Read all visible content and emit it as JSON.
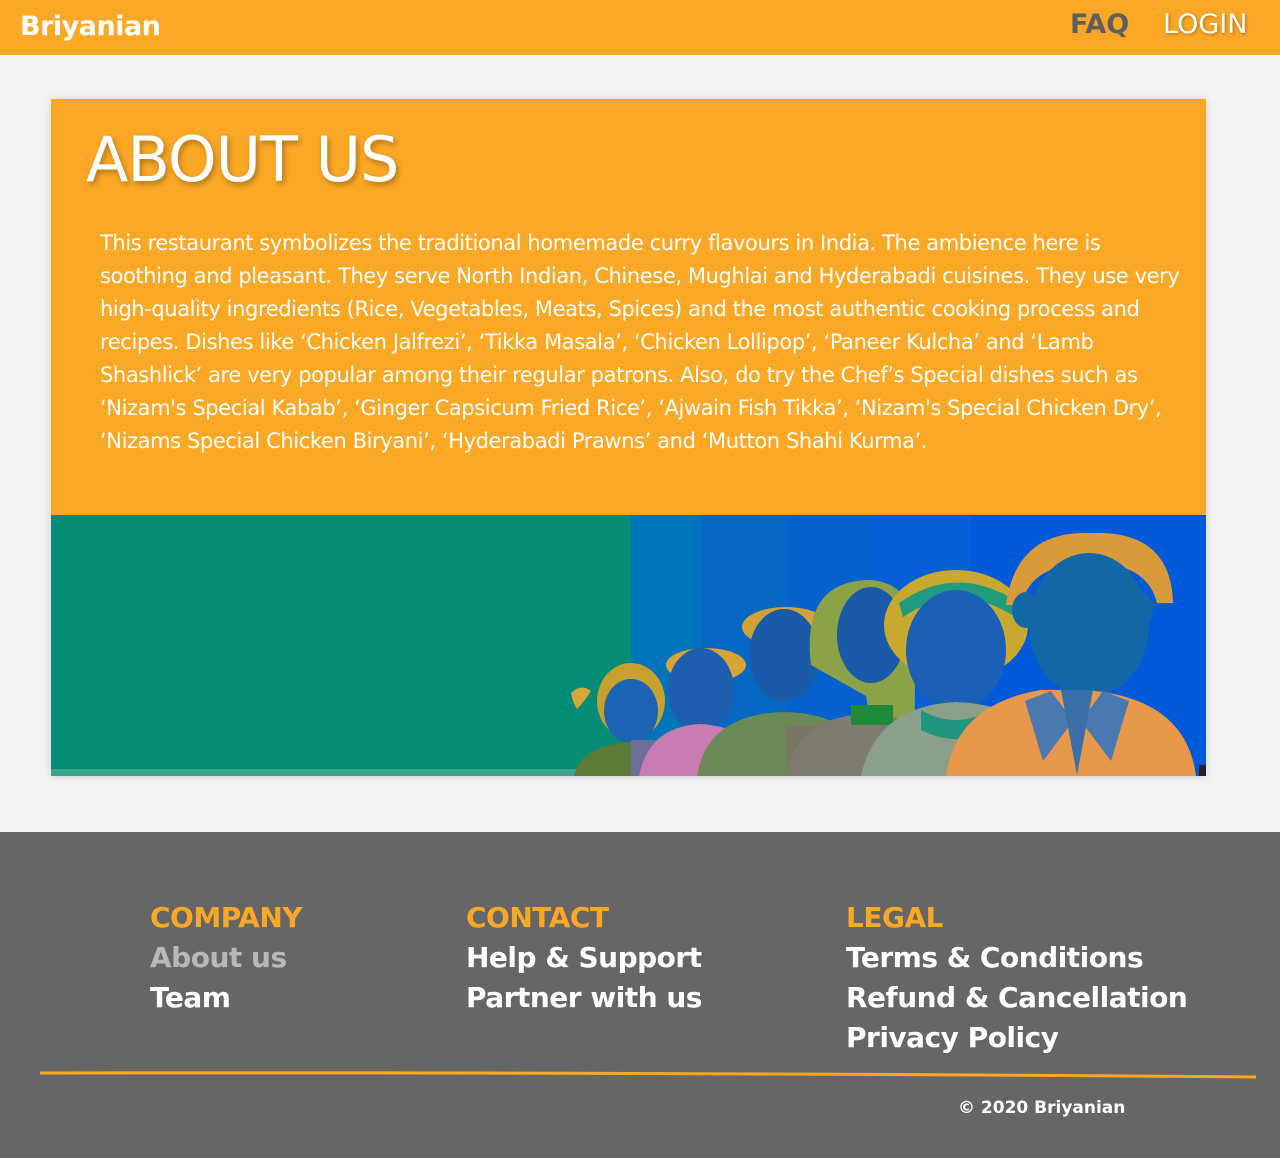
{
  "header": {
    "brand": "Briyanian",
    "nav": {
      "faq": "FAQ",
      "login": "LOGIN"
    }
  },
  "about": {
    "title": "ABOUT US",
    "body": "This restaurant symbolizes the traditional homemade curry flavours in India. The ambience here is soothing and pleasant. They serve North Indian, Chinese, Mughlai and Hyderabadi cuisines. They use very high-quality ingredients (Rice, Vegetables, Meats, Spices) and the most authentic cooking process and recipes. Dishes like ‘Chicken Jalfrezi’, ‘Tikka Masala’, ‘Chicken Lollipop’, ‘Paneer Kulcha’ and ‘Lamb Shashlick’ are very popular among their regular patrons. Also, do try the Chef’s Special dishes such as ‘Nizam's Special Kabab’, ‘Ginger Capsicum Fried Rice’, ‘Ajwain Fish Tikka’, ‘Nizam's Special Chicken Dry’, ‘Nizams Special Chicken Biryani’, ‘Hyderabadi Prawns’ and ‘Mutton Shahi Kurma’."
  },
  "footer": {
    "company": {
      "heading": "COMPANY",
      "links": [
        "About us",
        "Team"
      ]
    },
    "contact": {
      "heading": "CONTACT",
      "links": [
        "Help & Support",
        "Partner with us"
      ]
    },
    "legal": {
      "heading": "LEGAL",
      "links": [
        "Terms & Conditions",
        "Refund & Cancellation",
        "Privacy Policy"
      ]
    },
    "copyright": "© 2020 Briyanian"
  },
  "colors": {
    "brand_orange": "#fba826",
    "footer_gray": "#666666",
    "banner_teal": "#058c77",
    "banner_blue": "#0059d9",
    "faq_gray": "#5f5f5f"
  }
}
